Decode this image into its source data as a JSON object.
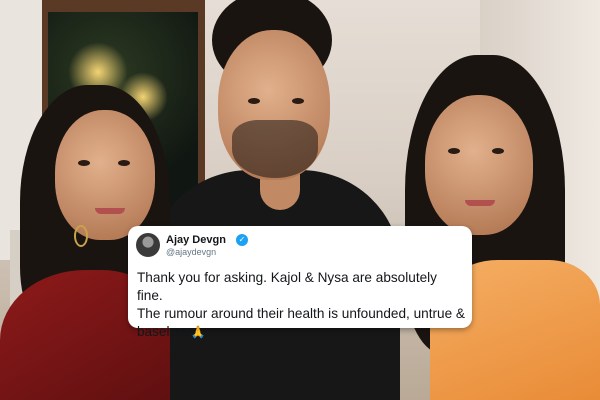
{
  "tweet": {
    "display_name": "Ajay Devgn",
    "handle": "@ajaydevgn",
    "verified": true,
    "text_lines": [
      "Thank you for asking. Kajol & Nysa are absolutely fine.",
      "The rumour around their health is unfounded, untrue &",
      "baseless"
    ],
    "emoji": "🙏"
  },
  "photo": {
    "description_icon": "family-photo"
  },
  "colors": {
    "verified_blue": "#1da1f2",
    "card_bg": "#ffffff"
  }
}
